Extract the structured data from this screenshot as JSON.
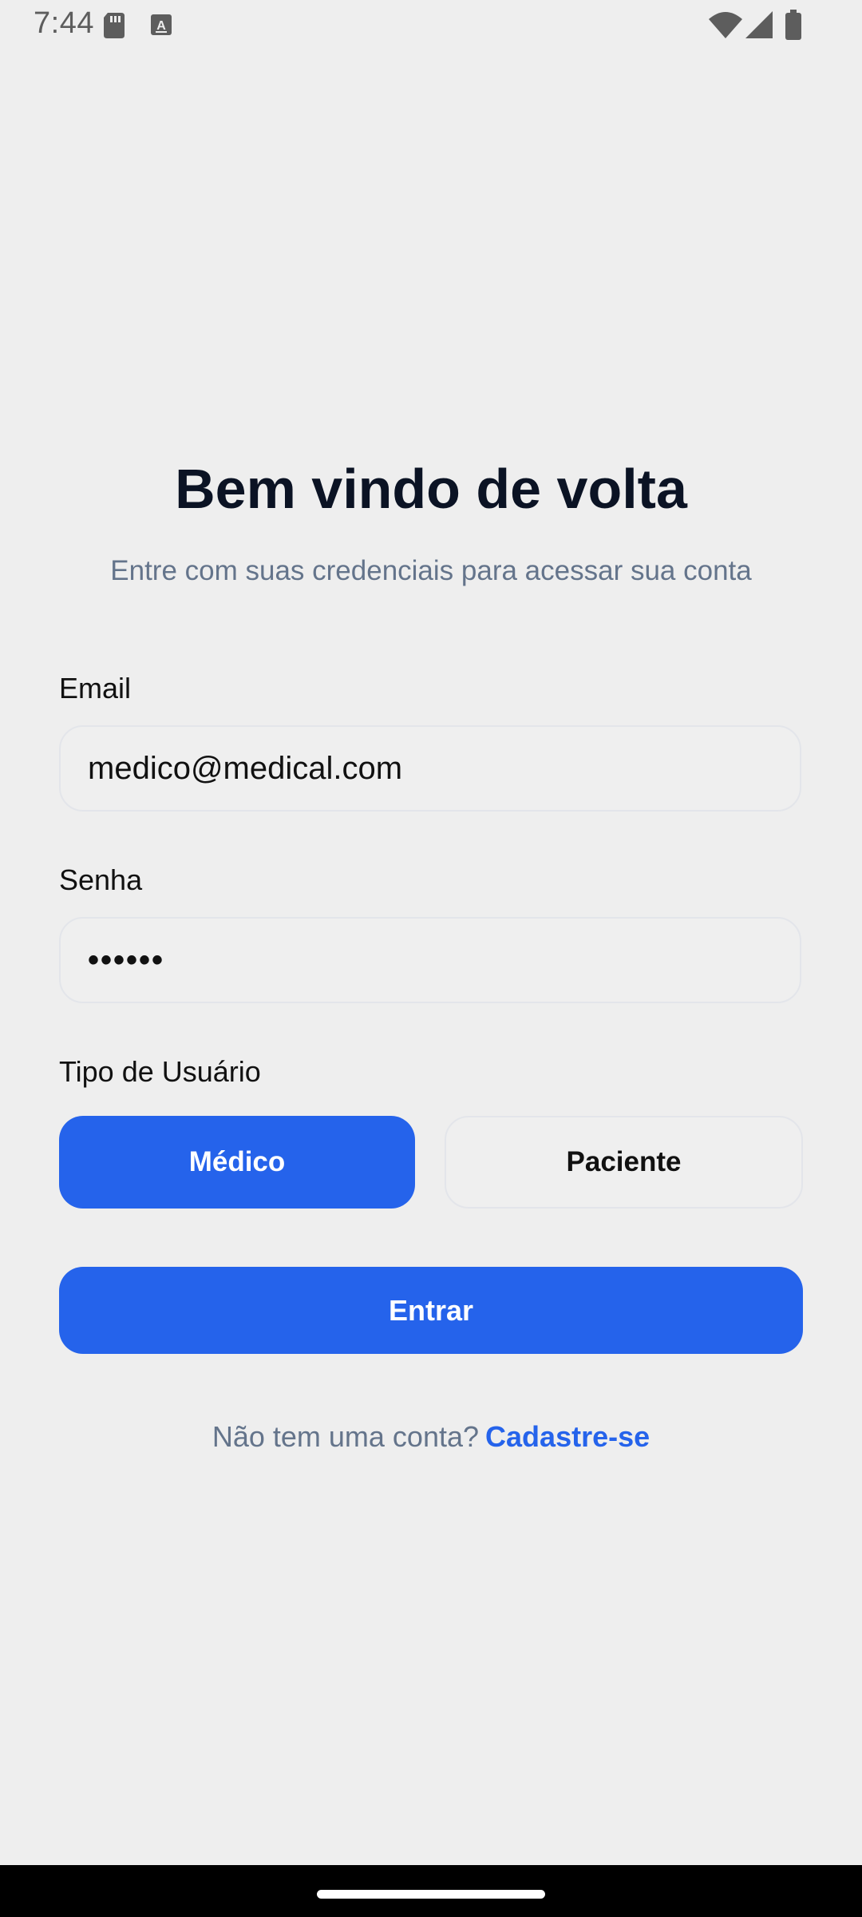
{
  "status_bar": {
    "time": "7:44",
    "icons": [
      "sd-card-icon",
      "a-icon",
      "wifi-icon",
      "signal-icon",
      "battery-icon"
    ]
  },
  "login": {
    "title": "Bem vindo de volta",
    "subtitle": "Entre com suas credenciais para acessar sua conta",
    "email_label": "Email",
    "email_value": "medico@medical.com",
    "password_label": "Senha",
    "password_value": "••••••",
    "user_type_label": "Tipo de Usuário",
    "user_types": [
      {
        "label": "Médico",
        "selected": true
      },
      {
        "label": "Paciente",
        "selected": false
      }
    ],
    "submit_label": "Entrar",
    "signup_prompt": "Não tem uma conta?",
    "signup_link": "Cadastre-se"
  },
  "colors": {
    "background": "#eeeeee",
    "primary": "#2563eb",
    "title": "#0b1324",
    "muted_text": "#64748b",
    "input_border": "#e3e5ea"
  }
}
